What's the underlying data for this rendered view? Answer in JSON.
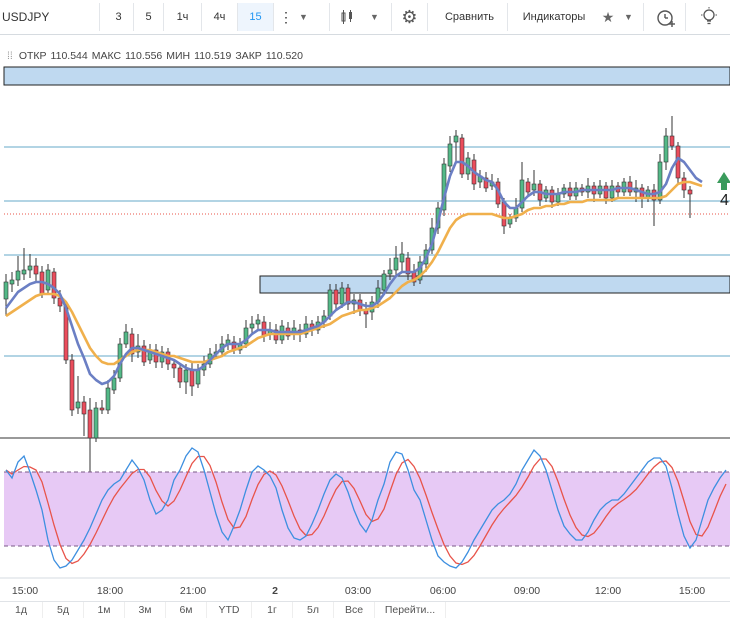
{
  "toolbar": {
    "symbol": "USDJPY",
    "intervals": [
      "3",
      "5",
      "1ч",
      "4ч",
      "15"
    ],
    "active_interval": "15",
    "compare_label": "Сравнить",
    "indicators_label": "Индикаторы"
  },
  "legend": {
    "open_label": "ОТКР",
    "open": "110.544",
    "high_label": "МАКС",
    "high": "110.556",
    "low_label": "МИН",
    "low": "110.519",
    "close_label": "ЗАКР",
    "close": "110.520"
  },
  "time_labels": [
    "15:00",
    "18:00",
    "21:00",
    "2",
    "03:00",
    "06:00",
    "09:00",
    "12:00",
    "15:00"
  ],
  "marker_text": "4",
  "ranges": [
    "1д",
    "5д",
    "1м",
    "3м",
    "6м",
    "YTD",
    "1г",
    "5л",
    "Все",
    "Перейти..."
  ],
  "colors": {
    "up": "#53b987",
    "down": "#eb4d5c",
    "wick": "#333333",
    "ma_fast": "#6b7fc4",
    "ma_slow": "#f0b04c",
    "zone_fill": "#bfd9f0",
    "hline": "#66a9c9",
    "osc_band": "#e7c9f5",
    "osc_k": "#3d8fe0",
    "osc_d": "#e8544a",
    "arrow": "#3a9b5c"
  },
  "chart_data": {
    "type": "candlestick",
    "x_index_range": [
      0,
      120
    ],
    "candles": [
      {
        "o": 241,
        "c": 224,
        "h": 216,
        "l": 258
      },
      {
        "o": 226,
        "c": 222,
        "h": 214,
        "l": 234
      },
      {
        "o": 222,
        "c": 213,
        "h": 198,
        "l": 228
      },
      {
        "o": 216,
        "c": 212,
        "h": 190,
        "l": 222
      },
      {
        "o": 212,
        "c": 208,
        "h": 196,
        "l": 220
      },
      {
        "o": 208,
        "c": 216,
        "h": 200,
        "l": 224
      },
      {
        "o": 214,
        "c": 236,
        "h": 208,
        "l": 240
      },
      {
        "o": 232,
        "c": 212,
        "h": 206,
        "l": 236
      },
      {
        "o": 214,
        "c": 240,
        "h": 210,
        "l": 246
      },
      {
        "o": 240,
        "c": 248,
        "h": 232,
        "l": 254
      },
      {
        "o": 248,
        "c": 302,
        "h": 244,
        "l": 306
      },
      {
        "o": 302,
        "c": 352,
        "h": 296,
        "l": 358
      },
      {
        "o": 350,
        "c": 344,
        "h": 318,
        "l": 356
      },
      {
        "o": 344,
        "c": 356,
        "h": 338,
        "l": 378
      },
      {
        "o": 352,
        "c": 380,
        "h": 340,
        "l": 418
      },
      {
        "o": 380,
        "c": 350,
        "h": 344,
        "l": 384
      },
      {
        "o": 350,
        "c": 352,
        "h": 342,
        "l": 356
      },
      {
        "o": 352,
        "c": 330,
        "h": 322,
        "l": 356
      },
      {
        "o": 332,
        "c": 320,
        "h": 312,
        "l": 336
      },
      {
        "o": 320,
        "c": 286,
        "h": 280,
        "l": 324
      },
      {
        "o": 286,
        "c": 274,
        "h": 266,
        "l": 290
      },
      {
        "o": 276,
        "c": 296,
        "h": 270,
        "l": 304
      },
      {
        "o": 294,
        "c": 288,
        "h": 276,
        "l": 300
      },
      {
        "o": 288,
        "c": 304,
        "h": 282,
        "l": 308
      },
      {
        "o": 302,
        "c": 292,
        "h": 286,
        "l": 306
      },
      {
        "o": 292,
        "c": 304,
        "h": 286,
        "l": 310
      },
      {
        "o": 304,
        "c": 294,
        "h": 288,
        "l": 310
      },
      {
        "o": 294,
        "c": 306,
        "h": 290,
        "l": 312
      },
      {
        "o": 306,
        "c": 310,
        "h": 302,
        "l": 320
      },
      {
        "o": 310,
        "c": 324,
        "h": 306,
        "l": 330
      },
      {
        "o": 324,
        "c": 312,
        "h": 306,
        "l": 336
      },
      {
        "o": 312,
        "c": 328,
        "h": 304,
        "l": 338
      },
      {
        "o": 326,
        "c": 312,
        "h": 306,
        "l": 330
      },
      {
        "o": 312,
        "c": 306,
        "h": 298,
        "l": 318
      },
      {
        "o": 306,
        "c": 296,
        "h": 290,
        "l": 310
      },
      {
        "o": 296,
        "c": 294,
        "h": 286,
        "l": 300
      },
      {
        "o": 294,
        "c": 286,
        "h": 278,
        "l": 298
      },
      {
        "o": 286,
        "c": 282,
        "h": 276,
        "l": 292
      },
      {
        "o": 284,
        "c": 292,
        "h": 278,
        "l": 296
      },
      {
        "o": 292,
        "c": 286,
        "h": 280,
        "l": 296
      },
      {
        "o": 286,
        "c": 270,
        "h": 262,
        "l": 290
      },
      {
        "o": 270,
        "c": 266,
        "h": 258,
        "l": 276
      },
      {
        "o": 266,
        "c": 262,
        "h": 256,
        "l": 272
      },
      {
        "o": 264,
        "c": 278,
        "h": 258,
        "l": 284
      },
      {
        "o": 276,
        "c": 272,
        "h": 264,
        "l": 282
      },
      {
        "o": 272,
        "c": 282,
        "h": 266,
        "l": 286
      },
      {
        "o": 282,
        "c": 268,
        "h": 262,
        "l": 286
      },
      {
        "o": 270,
        "c": 278,
        "h": 264,
        "l": 282
      },
      {
        "o": 276,
        "c": 270,
        "h": 262,
        "l": 282
      },
      {
        "o": 272,
        "c": 276,
        "h": 266,
        "l": 284
      },
      {
        "o": 276,
        "c": 266,
        "h": 258,
        "l": 280
      },
      {
        "o": 266,
        "c": 272,
        "h": 262,
        "l": 278
      },
      {
        "o": 272,
        "c": 264,
        "h": 258,
        "l": 276
      },
      {
        "o": 264,
        "c": 258,
        "h": 252,
        "l": 270
      },
      {
        "o": 258,
        "c": 232,
        "h": 226,
        "l": 262
      },
      {
        "o": 232,
        "c": 246,
        "h": 226,
        "l": 252
      },
      {
        "o": 246,
        "c": 230,
        "h": 224,
        "l": 250
      },
      {
        "o": 230,
        "c": 246,
        "h": 226,
        "l": 252
      },
      {
        "o": 246,
        "c": 242,
        "h": 236,
        "l": 256
      },
      {
        "o": 242,
        "c": 252,
        "h": 236,
        "l": 258
      },
      {
        "o": 252,
        "c": 256,
        "h": 244,
        "l": 270
      },
      {
        "o": 254,
        "c": 244,
        "h": 238,
        "l": 262
      },
      {
        "o": 244,
        "c": 230,
        "h": 222,
        "l": 250
      },
      {
        "o": 232,
        "c": 216,
        "h": 212,
        "l": 236
      },
      {
        "o": 216,
        "c": 212,
        "h": 200,
        "l": 222
      },
      {
        "o": 212,
        "c": 200,
        "h": 188,
        "l": 218
      },
      {
        "o": 204,
        "c": 196,
        "h": 184,
        "l": 214
      },
      {
        "o": 200,
        "c": 216,
        "h": 194,
        "l": 222
      },
      {
        "o": 214,
        "c": 224,
        "h": 206,
        "l": 228
      },
      {
        "o": 222,
        "c": 204,
        "h": 198,
        "l": 226
      },
      {
        "o": 206,
        "c": 192,
        "h": 186,
        "l": 214
      },
      {
        "o": 192,
        "c": 170,
        "h": 160,
        "l": 196
      },
      {
        "o": 170,
        "c": 150,
        "h": 144,
        "l": 176
      },
      {
        "o": 152,
        "c": 106,
        "h": 100,
        "l": 158
      },
      {
        "o": 108,
        "c": 86,
        "h": 78,
        "l": 114
      },
      {
        "o": 84,
        "c": 78,
        "h": 72,
        "l": 106
      },
      {
        "o": 80,
        "c": 116,
        "h": 76,
        "l": 120
      },
      {
        "o": 116,
        "c": 100,
        "h": 94,
        "l": 122
      },
      {
        "o": 102,
        "c": 126,
        "h": 96,
        "l": 132
      },
      {
        "o": 124,
        "c": 118,
        "h": 112,
        "l": 130
      },
      {
        "o": 120,
        "c": 130,
        "h": 114,
        "l": 134
      },
      {
        "o": 128,
        "c": 124,
        "h": 116,
        "l": 132
      },
      {
        "o": 124,
        "c": 146,
        "h": 120,
        "l": 150
      },
      {
        "o": 144,
        "c": 168,
        "h": 140,
        "l": 176
      },
      {
        "o": 166,
        "c": 160,
        "h": 156,
        "l": 170
      },
      {
        "o": 160,
        "c": 150,
        "h": 140,
        "l": 164
      },
      {
        "o": 150,
        "c": 122,
        "h": 104,
        "l": 154
      },
      {
        "o": 124,
        "c": 134,
        "h": 120,
        "l": 138
      },
      {
        "o": 132,
        "c": 126,
        "h": 112,
        "l": 138
      },
      {
        "o": 126,
        "c": 142,
        "h": 122,
        "l": 148
      },
      {
        "o": 140,
        "c": 132,
        "h": 128,
        "l": 144
      },
      {
        "o": 132,
        "c": 144,
        "h": 128,
        "l": 150
      },
      {
        "o": 144,
        "c": 136,
        "h": 130,
        "l": 148
      },
      {
        "o": 136,
        "c": 130,
        "h": 126,
        "l": 140
      },
      {
        "o": 130,
        "c": 138,
        "h": 124,
        "l": 142
      },
      {
        "o": 138,
        "c": 130,
        "h": 124,
        "l": 142
      },
      {
        "o": 130,
        "c": 134,
        "h": 126,
        "l": 138
      },
      {
        "o": 134,
        "c": 128,
        "h": 120,
        "l": 140
      },
      {
        "o": 128,
        "c": 136,
        "h": 124,
        "l": 144
      },
      {
        "o": 136,
        "c": 128,
        "h": 122,
        "l": 140
      },
      {
        "o": 128,
        "c": 140,
        "h": 124,
        "l": 146
      },
      {
        "o": 140,
        "c": 128,
        "h": 122,
        "l": 144
      },
      {
        "o": 128,
        "c": 134,
        "h": 124,
        "l": 140
      },
      {
        "o": 134,
        "c": 124,
        "h": 120,
        "l": 138
      },
      {
        "o": 124,
        "c": 134,
        "h": 118,
        "l": 138
      },
      {
        "o": 134,
        "c": 130,
        "h": 122,
        "l": 144
      },
      {
        "o": 130,
        "c": 140,
        "h": 126,
        "l": 150
      },
      {
        "o": 140,
        "c": 132,
        "h": 128,
        "l": 144
      },
      {
        "o": 132,
        "c": 142,
        "h": 126,
        "l": 168
      },
      {
        "o": 142,
        "c": 104,
        "h": 96,
        "l": 146
      },
      {
        "o": 104,
        "c": 78,
        "h": 70,
        "l": 112
      },
      {
        "o": 78,
        "c": 88,
        "h": 58,
        "l": 92
      },
      {
        "o": 88,
        "c": 120,
        "h": 84,
        "l": 126
      },
      {
        "o": 120,
        "c": 132,
        "h": 114,
        "l": 140
      },
      {
        "o": 132,
        "c": 136,
        "h": 128,
        "l": 160
      }
    ],
    "y_pixel_note": "",
    "ma_fast": [
      250,
      242,
      234,
      230,
      226,
      224,
      224,
      226,
      230,
      236,
      250,
      268,
      286,
      300,
      316,
      322,
      326,
      324,
      318,
      306,
      296,
      290,
      290,
      292,
      294,
      296,
      298,
      300,
      302,
      306,
      310,
      312,
      312,
      308,
      302,
      296,
      290,
      286,
      286,
      286,
      282,
      276,
      272,
      272,
      272,
      274,
      274,
      274,
      274,
      274,
      272,
      270,
      268,
      264,
      258,
      252,
      248,
      244,
      244,
      246,
      248,
      248,
      244,
      236,
      226,
      218,
      214,
      214,
      214,
      210,
      200,
      186,
      164,
      140,
      118,
      104,
      104,
      108,
      114,
      118,
      122,
      124,
      132,
      144,
      150,
      150,
      144,
      138,
      134,
      134,
      136,
      136,
      136,
      134,
      134,
      134,
      132,
      132,
      132,
      132,
      132,
      132,
      130,
      130,
      130,
      132,
      134,
      136,
      136,
      134,
      126,
      110,
      100,
      104,
      112,
      120,
      124
    ],
    "ma_slow": [
      258,
      254,
      250,
      246,
      242,
      238,
      236,
      236,
      236,
      238,
      244,
      254,
      266,
      278,
      290,
      298,
      304,
      306,
      306,
      302,
      298,
      294,
      292,
      292,
      292,
      294,
      296,
      298,
      298,
      300,
      302,
      304,
      304,
      304,
      302,
      300,
      298,
      294,
      292,
      290,
      288,
      284,
      280,
      278,
      276,
      276,
      276,
      276,
      276,
      276,
      274,
      272,
      270,
      268,
      266,
      262,
      258,
      256,
      254,
      252,
      252,
      250,
      248,
      244,
      240,
      234,
      228,
      224,
      222,
      218,
      212,
      204,
      194,
      182,
      170,
      162,
      158,
      156,
      156,
      156,
      156,
      156,
      158,
      160,
      160,
      158,
      156,
      152,
      150,
      150,
      148,
      148,
      146,
      146,
      144,
      144,
      144,
      142,
      142,
      142,
      142,
      142,
      140,
      140,
      140,
      140,
      140,
      140,
      140,
      140,
      138,
      132,
      126,
      124,
      124,
      126,
      128
    ]
  }
}
